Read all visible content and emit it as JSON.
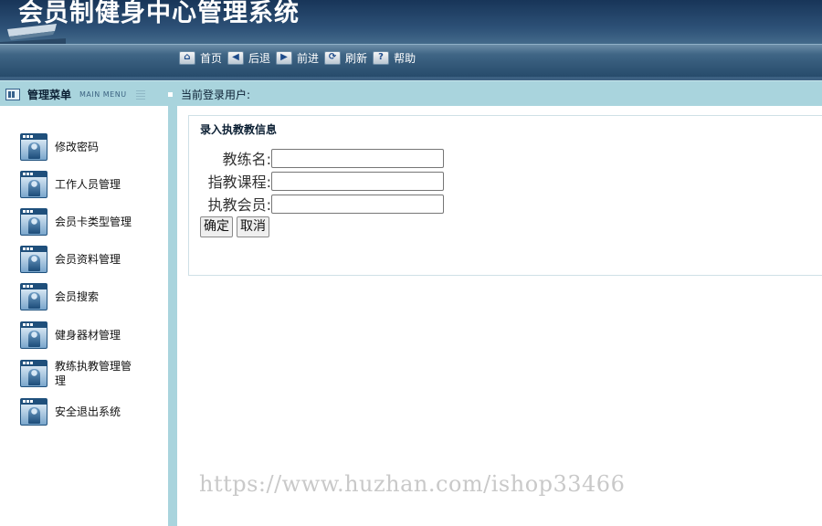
{
  "header": {
    "title": "会员制健身中心管理系统"
  },
  "toolbar": {
    "items": [
      {
        "label": "首页",
        "icon": "home-icon",
        "glyph": "⌂"
      },
      {
        "label": "后退",
        "icon": "arrow-left-icon",
        "glyph": "◀"
      },
      {
        "label": "前进",
        "icon": "arrow-right-icon",
        "glyph": "▶"
      },
      {
        "label": "刷新",
        "icon": "refresh-icon",
        "glyph": "⟳"
      },
      {
        "label": "帮助",
        "icon": "help-icon",
        "glyph": "?"
      }
    ]
  },
  "menu_header": {
    "title": "管理菜单",
    "subtitle": "MAIN MENU"
  },
  "user_bar": {
    "label": "当前登录用户:"
  },
  "sidebar": {
    "items": [
      {
        "label": "修改密码"
      },
      {
        "label": "工作人员管理"
      },
      {
        "label": "会员卡类型管理"
      },
      {
        "label": "会员资料管理"
      },
      {
        "label": "会员搜索"
      },
      {
        "label": "健身器材管理"
      },
      {
        "label": "教练执教管理管\n理"
      },
      {
        "label": "安全退出系统"
      }
    ]
  },
  "form": {
    "title": "录入执教教信息",
    "fields": [
      {
        "label": "教练名:",
        "value": ""
      },
      {
        "label": "指教课程:",
        "value": ""
      },
      {
        "label": "执教会员:",
        "value": ""
      }
    ],
    "confirm_label": "确定",
    "cancel_label": "取消"
  },
  "watermark": "https://www.huzhan.com/ishop33466",
  "colors": {
    "header_dark": "#183558",
    "title_bar": "#a9d4dd",
    "panel_border": "#cfe0e6"
  }
}
